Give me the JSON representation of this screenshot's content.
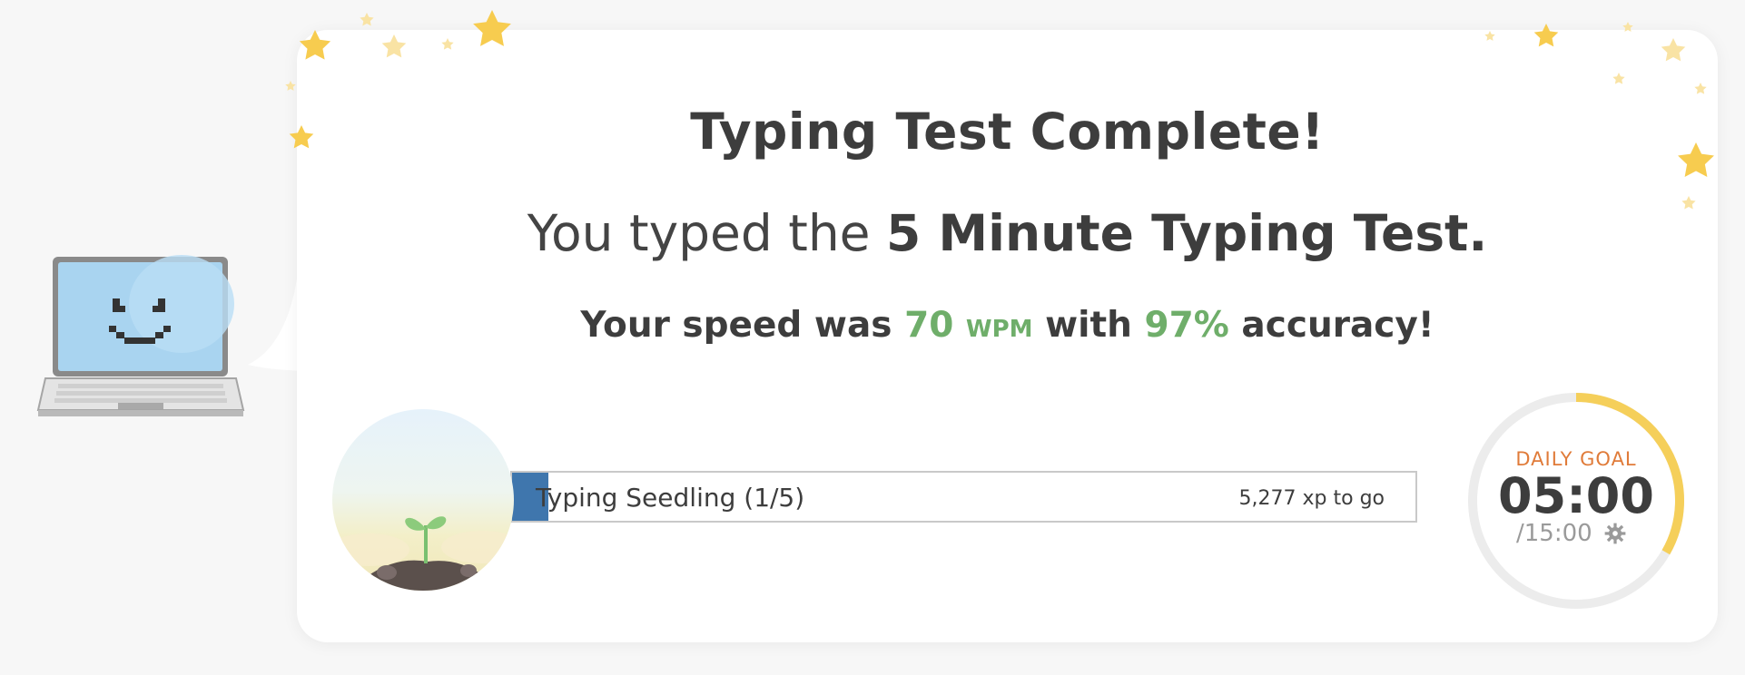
{
  "result": {
    "title": "Typing Test Complete!",
    "typed_prefix": "You typed the ",
    "test_name": "5 Minute Typing Test",
    "typed_suffix": ".",
    "speed_prefix": "Your speed was ",
    "speed_value": "70",
    "speed_unit": "WPM",
    "speed_middle": " with ",
    "accuracy_value": "97%",
    "accuracy_suffix": " accuracy!"
  },
  "level": {
    "name": "Typing Seedling (1/5)",
    "xp_remaining": "5,277 xp to go",
    "progress_fraction": 0.04
  },
  "daily_goal": {
    "label": "DAILY GOAL",
    "time": "05:00",
    "total": "/15:00",
    "progress_fraction": 0.333
  },
  "icons": {
    "mascot": "laptop-mascot-icon",
    "seedling": "seedling-icon",
    "settings": "gear-icon",
    "decoration": "star-icon"
  },
  "colors": {
    "accent_green": "#6fae6a",
    "level_blue": "#3f76ad",
    "goal_orange": "#e07b39",
    "goal_ring": "#f5cf5a",
    "star_yellow": "#f7cc4f"
  }
}
